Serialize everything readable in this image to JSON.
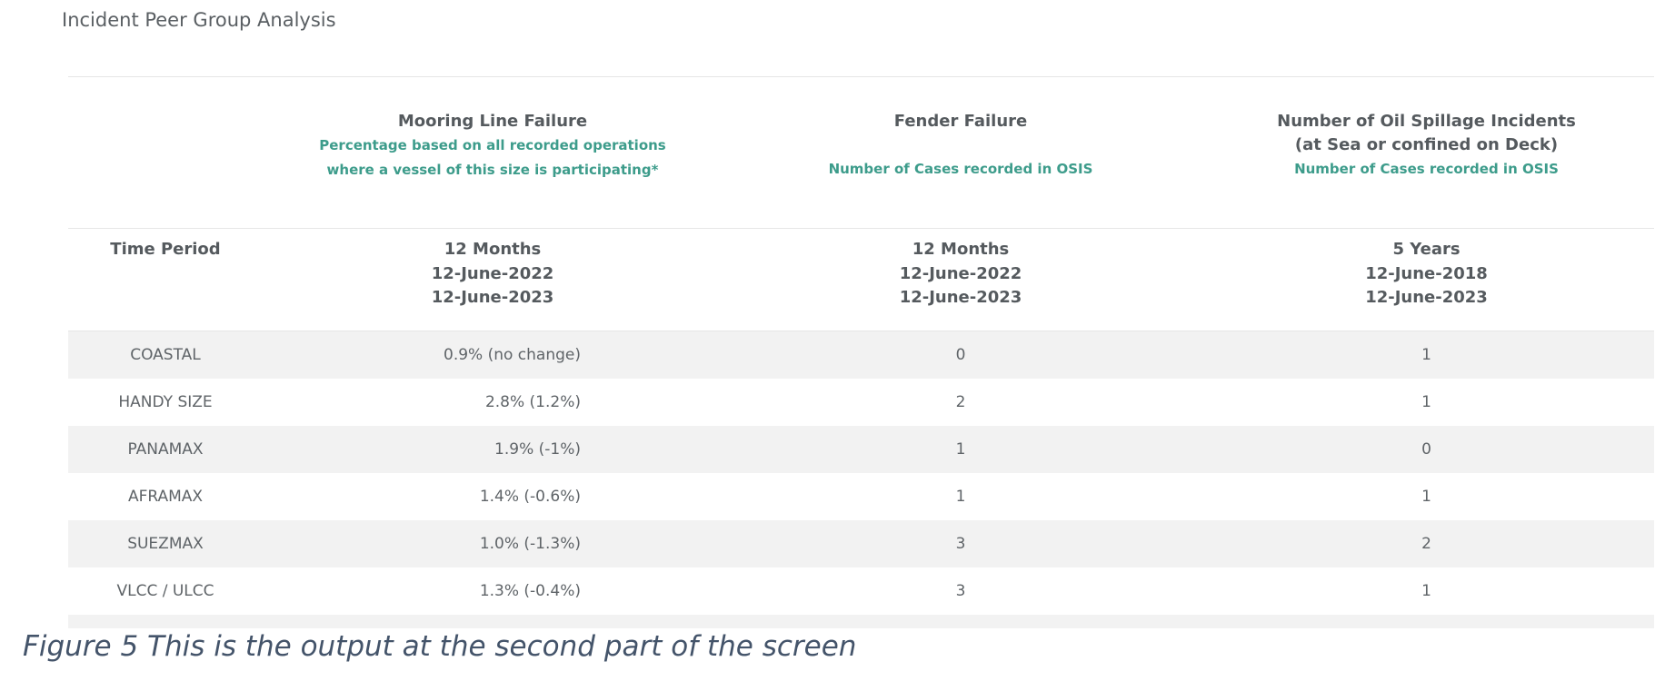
{
  "section_title": "Incident Peer Group Analysis",
  "columns": [
    {
      "title_lines": [
        "Mooring Line Failure"
      ],
      "subtitle_lines": [
        "Percentage based on all recorded operations",
        "where a vessel of this size is participating*"
      ],
      "period_lines": [
        "12 Months",
        "12-June-2022",
        "12-June-2023"
      ]
    },
    {
      "title_lines": [
        "Fender Failure"
      ],
      "subtitle_lines": [
        "",
        "Number of Cases recorded in OSIS"
      ],
      "period_lines": [
        "12 Months",
        "12-June-2022",
        "12-June-2023"
      ]
    },
    {
      "title_lines": [
        "Number of Oil Spillage Incidents",
        "(at Sea or confined on Deck)"
      ],
      "subtitle_lines": [
        "Number of Cases recorded in OSIS"
      ],
      "period_lines": [
        "5 Years",
        "12-June-2018",
        "12-June-2023"
      ]
    }
  ],
  "time_period_label": "Time Period",
  "rows": [
    {
      "vessel": "COASTAL",
      "mooring": "0.9% (no change)",
      "fender": "0",
      "oil": "1"
    },
    {
      "vessel": "HANDY SIZE",
      "mooring": "2.8% (1.2%)",
      "fender": "2",
      "oil": "1"
    },
    {
      "vessel": "PANAMAX",
      "mooring": "1.9% (-1%)",
      "fender": "1",
      "oil": "0"
    },
    {
      "vessel": "AFRAMAX",
      "mooring": "1.4% (-0.6%)",
      "fender": "1",
      "oil": "1"
    },
    {
      "vessel": "SUEZMAX",
      "mooring": "1.0% (-1.3%)",
      "fender": "3",
      "oil": "2"
    },
    {
      "vessel": "VLCC / ULCC",
      "mooring": "1.3% (-0.4%)",
      "fender": "3",
      "oil": "1"
    }
  ],
  "caption": "Figure 5 This is the output at the second part of the screen",
  "colors": {
    "accent_teal": "#3d9c8b",
    "stripe": "#f2f2f2",
    "caption_blue": "#44546a"
  }
}
